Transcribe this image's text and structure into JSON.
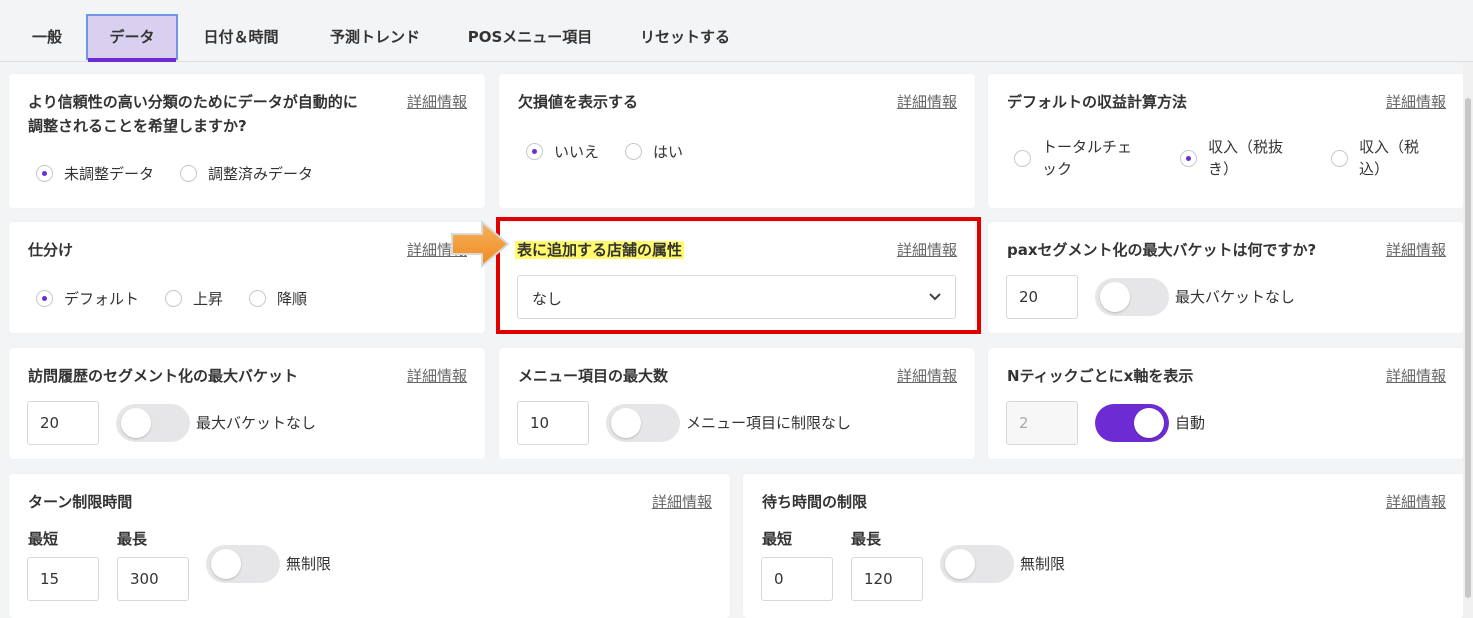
{
  "tabs": [
    "一般",
    "データ",
    "日付＆時間",
    "予測トレンド",
    "POSメニュー項目",
    "リセットする"
  ],
  "detail_label": "詳細情報",
  "cards": {
    "reliability": {
      "title_line1": "より信頼性の高い分類のためにデータが自動的に",
      "title_line2": "調整されることを希望しますか?",
      "options": [
        "未調整データ",
        "調整済みデータ"
      ],
      "selected": "未調整データ"
    },
    "missing": {
      "title": "欠損値を表示する",
      "options": [
        "いいえ",
        "はい"
      ],
      "selected": "いいえ"
    },
    "revenue": {
      "title": "デフォルトの収益計算方法",
      "options": [
        {
          "line1": "トータルチェ",
          "line2": "ック"
        },
        {
          "line1": "収入（税抜",
          "line2": "き）"
        },
        {
          "line1": "収入（税",
          "line2": "込）"
        }
      ],
      "selected_index": 1
    },
    "sort": {
      "title": "仕分け",
      "options": [
        "デフォルト",
        "上昇",
        "降順"
      ],
      "selected": "デフォルト"
    },
    "store_attr": {
      "title": "表に追加する店舗の属性",
      "select_value": "なし"
    },
    "pax": {
      "title": "paxセグメント化の最大バケットは何ですか?",
      "value": "20",
      "toggle_label": "最大バケットなし",
      "toggle_on": false
    },
    "visit": {
      "title": "訪問履歴のセグメント化の最大バケット",
      "value": "20",
      "toggle_label": "最大バケットなし",
      "toggle_on": false
    },
    "menu_max": {
      "title": "メニュー項目の最大数",
      "value": "10",
      "toggle_label": "メニュー項目に制限なし",
      "toggle_on": false
    },
    "xaxis": {
      "title": "Nティックごとにx軸を表示",
      "value": "2",
      "toggle_label": "自動",
      "toggle_on": true
    },
    "turn": {
      "title": "ターン制限時間",
      "min_label": "最短",
      "max_label": "最長",
      "min_value": "15",
      "max_value": "300",
      "toggle_label": "無制限",
      "toggle_on": false
    },
    "wait": {
      "title": "待ち時間の制限",
      "min_label": "最短",
      "max_label": "最長",
      "min_value": "0",
      "max_value": "120",
      "toggle_label": "無制限",
      "toggle_on": false
    }
  },
  "colors": {
    "accent": "#6d2cd3",
    "highlight": "#fffb6b",
    "annotation_box": "#e00000",
    "arrow": "#f5a142"
  }
}
